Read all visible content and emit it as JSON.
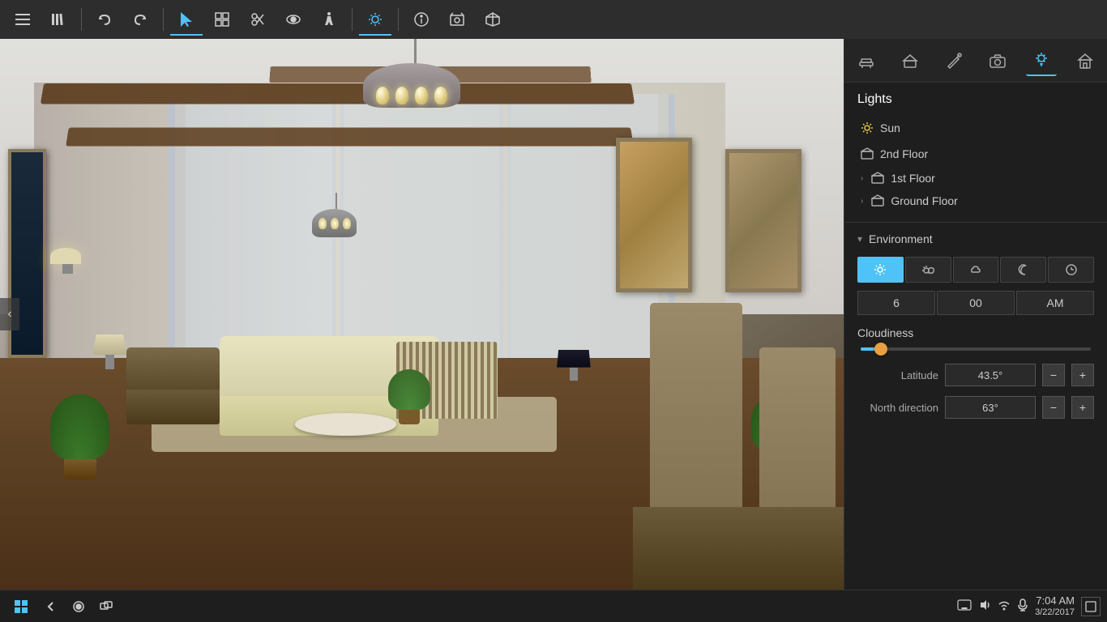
{
  "toolbar": {
    "buttons": [
      {
        "name": "menu-button",
        "icon": "≡",
        "label": "Menu",
        "active": false
      },
      {
        "name": "library-button",
        "icon": "📚",
        "label": "Library",
        "active": false
      },
      {
        "name": "undo-button",
        "icon": "↩",
        "label": "Undo",
        "active": false
      },
      {
        "name": "redo-button",
        "icon": "↪",
        "label": "Redo",
        "active": false
      },
      {
        "name": "select-button",
        "icon": "▲",
        "label": "Select",
        "active": true
      },
      {
        "name": "group-button",
        "icon": "⊞",
        "label": "Group",
        "active": false
      },
      {
        "name": "scissors-button",
        "icon": "✂",
        "label": "Scissors",
        "active": false
      },
      {
        "name": "view-button",
        "icon": "👁",
        "label": "View",
        "active": false
      },
      {
        "name": "walk-button",
        "icon": "🚶",
        "label": "Walk",
        "active": false
      },
      {
        "name": "sun-mode-button",
        "icon": "☀",
        "label": "Sun Mode",
        "active": true
      },
      {
        "name": "info-button",
        "icon": "ℹ",
        "label": "Info",
        "active": false
      },
      {
        "name": "screenshot-button",
        "icon": "⬚",
        "label": "Screenshot",
        "active": false
      },
      {
        "name": "3d-button",
        "icon": "⬡",
        "label": "3D",
        "active": false
      }
    ]
  },
  "right_toolbar": {
    "buttons": [
      {
        "name": "rt-furniture-btn",
        "icon": "🪑",
        "label": "Furniture",
        "active": false
      },
      {
        "name": "rt-build-btn",
        "icon": "🏗",
        "label": "Build",
        "active": false
      },
      {
        "name": "rt-paint-btn",
        "icon": "✏",
        "label": "Paint",
        "active": false
      },
      {
        "name": "rt-camera-btn",
        "icon": "📷",
        "label": "Camera",
        "active": false
      },
      {
        "name": "rt-lights-btn",
        "icon": "☀",
        "label": "Lights",
        "active": true
      },
      {
        "name": "rt-home-btn",
        "icon": "🏠",
        "label": "Home",
        "active": false
      }
    ]
  },
  "lights_panel": {
    "title": "Lights",
    "items": [
      {
        "name": "sun-item",
        "label": "Sun",
        "icon": "sun",
        "expandable": false
      },
      {
        "name": "2nd-floor-item",
        "label": "2nd Floor",
        "icon": "floor",
        "expandable": false
      },
      {
        "name": "1st-floor-item",
        "label": "1st Floor",
        "icon": "floor",
        "expandable": true
      },
      {
        "name": "ground-floor-item",
        "label": "Ground Floor",
        "icon": "floor",
        "expandable": true
      }
    ]
  },
  "environment": {
    "section_label": "Environment",
    "type_buttons": [
      {
        "name": "env-clear-btn",
        "icon": "☀",
        "label": "Clear Day",
        "active": true
      },
      {
        "name": "env-sunny-btn",
        "icon": "🌤",
        "label": "Partly Cloudy",
        "active": false
      },
      {
        "name": "env-cloudy-btn",
        "icon": "☁",
        "label": "Cloudy",
        "active": false
      },
      {
        "name": "env-night-btn",
        "icon": "☾",
        "label": "Night",
        "active": false
      },
      {
        "name": "env-clock-btn",
        "icon": "🕐",
        "label": "Custom Time",
        "active": false
      }
    ],
    "time": {
      "hour": "6",
      "minute": "00",
      "period": "AM"
    },
    "cloudiness_label": "Cloudiness",
    "cloudiness_value": 8,
    "latitude": {
      "label": "Latitude",
      "value": "43.5°"
    },
    "north_direction": {
      "label": "North direction",
      "value": "63°"
    }
  },
  "taskbar": {
    "time": "7:04 AM",
    "date": "3/22/2017",
    "icons": [
      "🔊",
      "⌨",
      "💬"
    ]
  },
  "viewport": {
    "nav_arrow": "‹"
  }
}
